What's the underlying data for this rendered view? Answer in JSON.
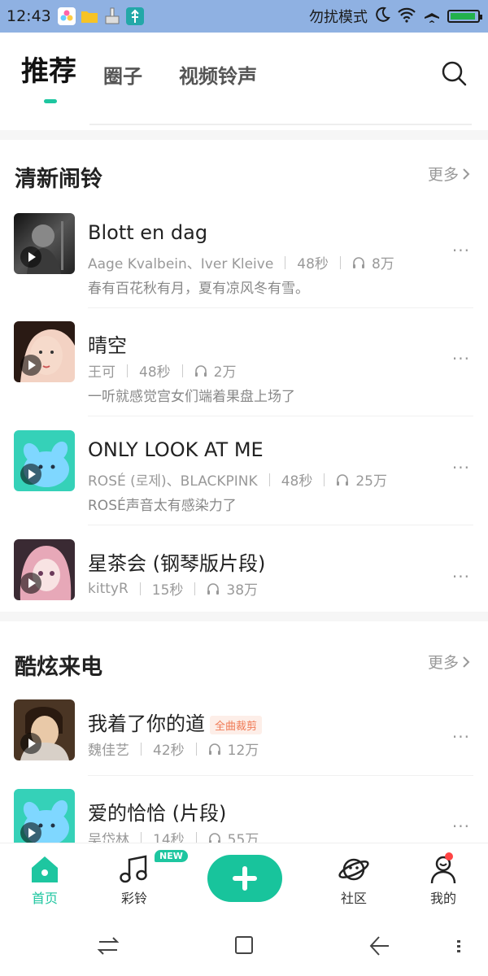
{
  "status_bar": {
    "time": "12:43",
    "dnd_label": "勿扰模式",
    "icons": [
      "photos-app-icon",
      "folder-icon",
      "cleaner-icon",
      "usb-icon",
      "moon-icon",
      "wifi-icon",
      "airplane-icon",
      "battery-icon"
    ],
    "battery_fill": 0.95
  },
  "tabs": {
    "active": "推荐",
    "items": [
      "推荐",
      "圈子",
      "视频铃声"
    ]
  },
  "sections": [
    {
      "title": "清新闹铃",
      "more": "更多",
      "items": [
        {
          "title": "Blott en dag",
          "artist": "Aage Kvalbein、Iver Kleive",
          "duration": "48秒",
          "plays": "8万",
          "desc": "春有百花秋有月，夏有凉风冬有雪。"
        },
        {
          "title": "晴空",
          "artist": "王可",
          "duration": "48秒",
          "plays": "2万",
          "desc": "一听就感觉宫女们端着果盘上场了"
        },
        {
          "title": "ONLY LOOK AT ME",
          "artist": "ROSÉ (로제)、BLACKPINK",
          "duration": "48秒",
          "plays": "25万",
          "desc": "ROSÉ声音太有感染力了"
        },
        {
          "title": "星茶会 (钢琴版片段)",
          "artist": "kittyR",
          "duration": "15秒",
          "plays": "38万",
          "desc": ""
        }
      ]
    },
    {
      "title": "酷炫来电",
      "more": "更多",
      "items": [
        {
          "title": "我着了你的道",
          "badge": "全曲裁剪",
          "artist": "魏佳艺",
          "duration": "42秒",
          "plays": "12万",
          "desc": ""
        },
        {
          "title": "爱的恰恰 (片段)",
          "artist": "吴岱林",
          "duration": "14秒",
          "plays": "55万",
          "desc": ""
        }
      ]
    }
  ],
  "bottom_nav": {
    "home": "首页",
    "cailing": "彩铃",
    "new_badge": "NEW",
    "shequ": "社区",
    "wode": "我的"
  },
  "colors": {
    "accent": "#1ec6a0",
    "status_bar": "#8fb1e2"
  }
}
